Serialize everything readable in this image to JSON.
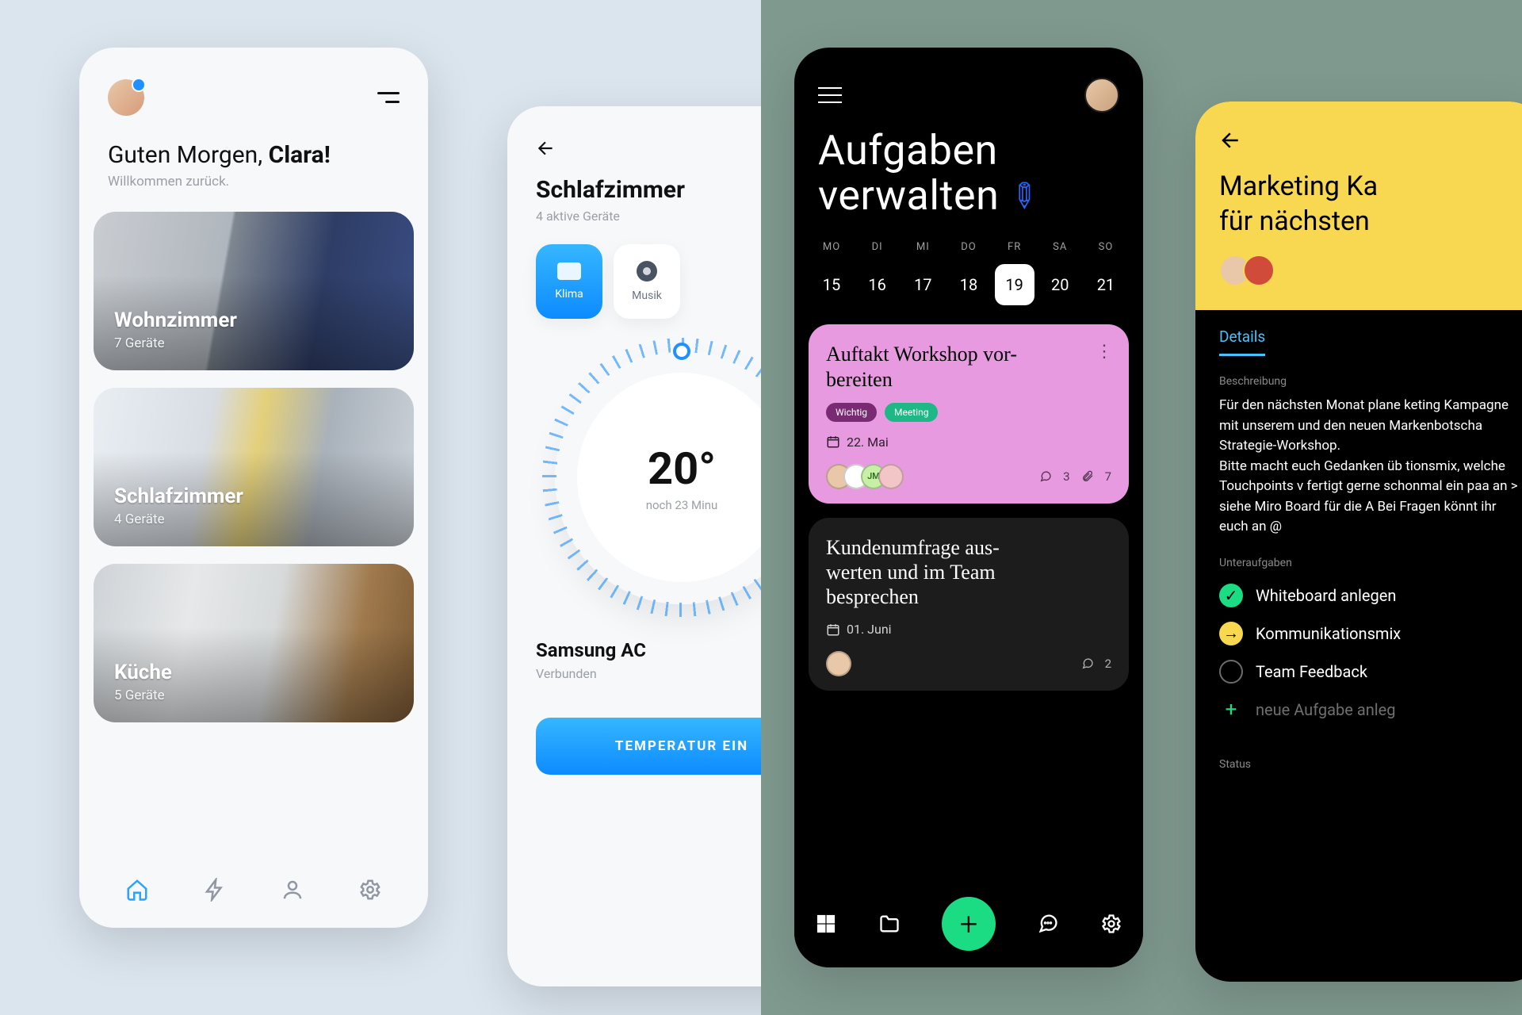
{
  "smarthome": {
    "home": {
      "greeting_prefix": "Guten Morgen, ",
      "greeting_name": "Clara!",
      "welcome": "Willkommen zurück.",
      "rooms": [
        {
          "name": "Wohnzimmer",
          "devices": "7 Geräte"
        },
        {
          "name": "Schlafzimmer",
          "devices": "4 Geräte"
        },
        {
          "name": "Küche",
          "devices": "5 Geräte"
        }
      ]
    },
    "room": {
      "title": "Schlafzimmer",
      "subtitle": "4 aktive Geräte",
      "chips": {
        "klima": "Klima",
        "musik": "Musik"
      },
      "temp": "20°",
      "remaining": "noch 23 Minu",
      "device_name": "Samsung AC",
      "device_status": "Verbunden",
      "cta": "TEMPERATUR EIN"
    }
  },
  "tasks": {
    "list": {
      "title_l1": "Aufgaben",
      "title_l2": "verwalten",
      "days": [
        {
          "dw": "MO",
          "dn": "15"
        },
        {
          "dw": "DI",
          "dn": "16"
        },
        {
          "dw": "MI",
          "dn": "17"
        },
        {
          "dw": "DO",
          "dn": "18"
        },
        {
          "dw": "FR",
          "dn": "19"
        },
        {
          "dw": "SA",
          "dn": "20"
        },
        {
          "dw": "SO",
          "dn": "21"
        }
      ],
      "selected_day_index": 4,
      "cards": [
        {
          "title": "Auftakt Workshop vor-\nbereiten",
          "tags": [
            "Wichtig",
            "Meeting"
          ],
          "date": "22. Mai",
          "comments": "3",
          "attachments": "7",
          "av_initials": "JM"
        },
        {
          "title": "Kundenumfrage aus-\nwerten und im Team besprechen",
          "date": "01. Juni",
          "comments": "2"
        }
      ]
    },
    "detail": {
      "title_l1": "Marketing Ka",
      "title_l2": "für nächsten ",
      "tab": "Details",
      "section_desc_label": "Beschreibung",
      "description": "Für den nächsten Monat plane keting Kampagne mit unserem und den neuen Markenbotscha Strategie-Workshop.\nBitte macht euch Gedanken üb tionsmix, welche Touchpoints v fertigt gerne schonmal ein paa an > siehe Miro Board für die A Bei Fragen könnt ihr euch an @",
      "section_sub_label": "Unteraufgaben",
      "subtasks": [
        {
          "state": "done",
          "label": "Whiteboard anlegen"
        },
        {
          "state": "prog",
          "label": "Kommunikationsmix"
        },
        {
          "state": "todo",
          "label": "Team Feedback"
        }
      ],
      "add_subtask": "neue Aufgabe anleg",
      "section_status_label": "Status"
    }
  }
}
